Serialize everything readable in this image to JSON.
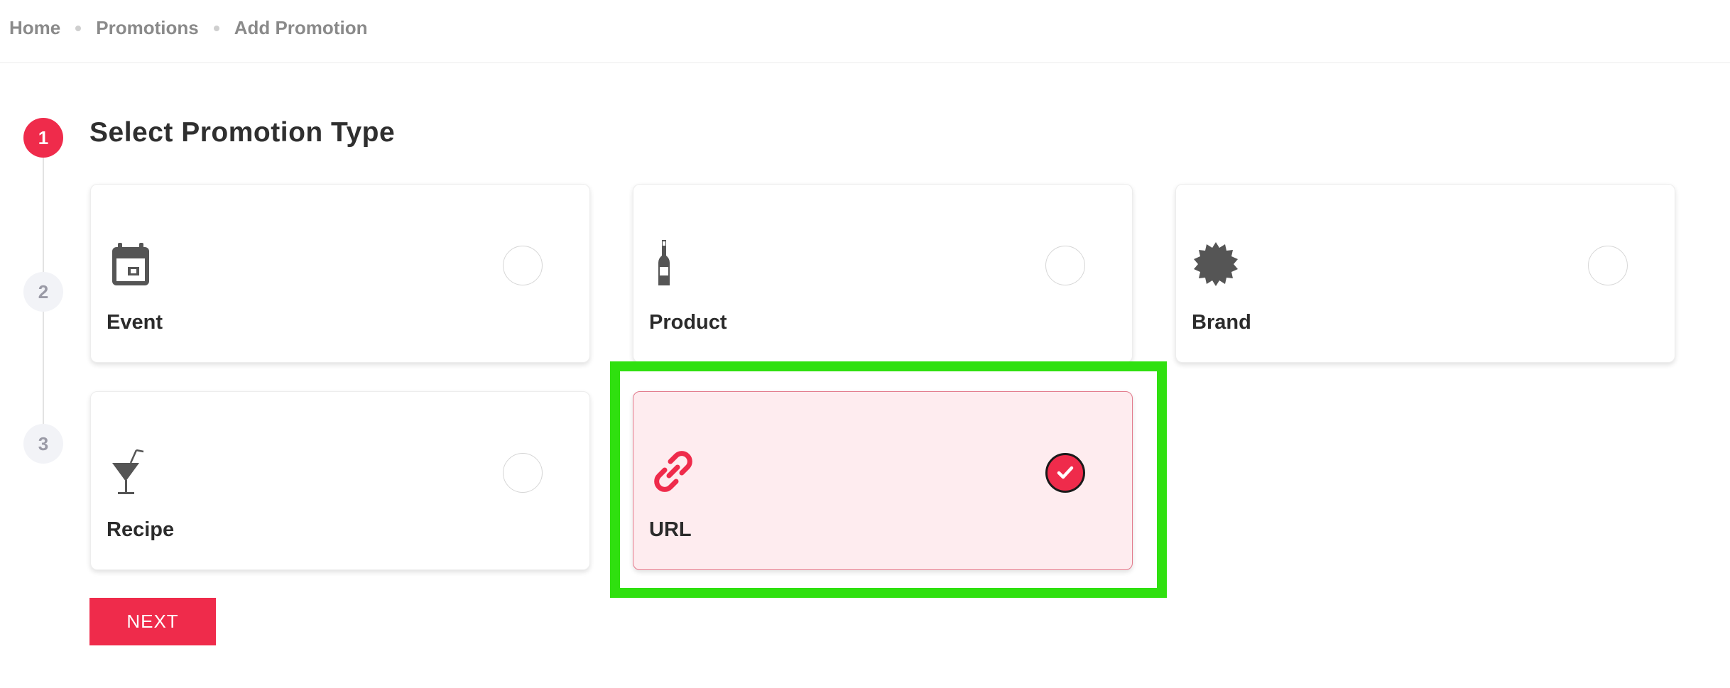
{
  "breadcrumb": {
    "items": [
      "Home",
      "Promotions",
      "Add Promotion"
    ]
  },
  "stepper": {
    "steps": [
      "1",
      "2",
      "3"
    ],
    "active_step": "1"
  },
  "section": {
    "title": "Select Promotion Type"
  },
  "promotion_types": [
    {
      "label": "Event",
      "icon": "calendar-icon",
      "selected": false
    },
    {
      "label": "Product",
      "icon": "bottle-icon",
      "selected": false
    },
    {
      "label": "Brand",
      "icon": "badge-icon",
      "selected": false
    },
    {
      "label": "Recipe",
      "icon": "cocktail-icon",
      "selected": false
    },
    {
      "label": "URL",
      "icon": "link-icon",
      "selected": true
    }
  ],
  "actions": {
    "next_label": "NEXT"
  },
  "colors": {
    "accent": "#ef2b4b",
    "selected_bg": "#feecef",
    "highlight": "#2fe00f"
  }
}
